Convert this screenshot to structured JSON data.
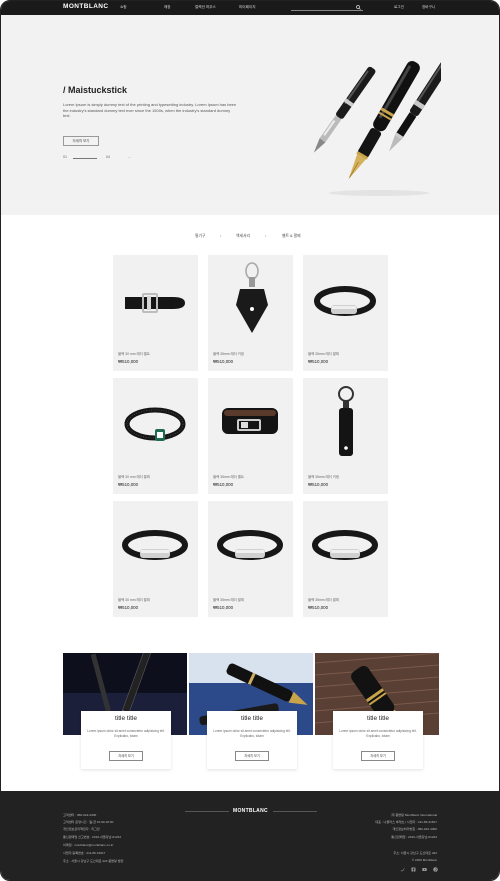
{
  "header": {
    "logo": "MONTBLANC",
    "nav": [
      "쇼핑",
      "매장",
      "컬렉션 하우스",
      "마이페이지"
    ],
    "right_nav": [
      "로그인",
      "장바구니"
    ]
  },
  "hero": {
    "title": "/ Maistuckstick",
    "text": "Lorem Ipsum is simply dummy text of the printing and typesetting industry. Lorem Ipsum has been the industry's standard dummy text ever since the 1500s, when the industry's standard dummy text.",
    "button": "자세히 보기",
    "slide_current": "01",
    "slide_total": "04",
    "next_arrow": "→"
  },
  "tabs": {
    "items": [
      "필기구",
      "액세서리",
      "벨트 & 팔찌"
    ],
    "separator": "•"
  },
  "products": [
    {
      "name": "블랙 30 mm 레더 벨트",
      "price": "₩510,000"
    },
    {
      "name": "블랙 35mm 레더 키링",
      "price": "₩510,000"
    },
    {
      "name": "블랙 35mm 레더 팔찌",
      "price": "₩510,000"
    },
    {
      "name": "블랙 30 mm 레더 팔찌",
      "price": "₩510,000"
    },
    {
      "name": "블랙 35mm 레더 벨트",
      "price": "₩510,000"
    },
    {
      "name": "블랙 35mm 레더 키링",
      "price": "₩510,000"
    },
    {
      "name": "블랙 30 mm 레더 팔찌",
      "price": "₩510,000"
    },
    {
      "name": "블랙 35mm 레더 팔찌",
      "price": "₩510,000"
    },
    {
      "name": "블랙 35mm 레더 팔찌",
      "price": "₩510,000"
    }
  ],
  "features": [
    {
      "title": "title title",
      "text": "Lorem ipsum dolor sit amet consectetur adipisicing elit. Explicabo, totam",
      "button": "자세히 보기"
    },
    {
      "title": "title title",
      "text": "Lorem ipsum dolor sit amet consectetur adipisicing elit. Explicabo, totam",
      "button": "자세히 보기"
    },
    {
      "title": "title title",
      "text": "Lorem ipsum dolor sit amet consectetur adipisicing elit. Explicabo, totam",
      "button": "자세히 보기"
    }
  ],
  "footer": {
    "logo": "MONTBLANC",
    "left": [
      "고객센터 : 080-022-4300",
      "고객센터 운영시간 : 월-금 10:00-18:00",
      "개인정보관리책임자 : 리그만",
      "통신판매업 신고번호 : 2016-서울강남-01234",
      "이메일 : montblanc@montblanc.co.kr",
      "사업자 등록번호 : 211-86-31817",
      "주소 : 서울시 강남구 도산대로 422 몽블랑 빌딩"
    ],
    "right": [
      "㈜ 몽블랑 Montblanc International",
      "대표 : 니콜라스 바레츠 | 사업자 : 211-86-31817",
      "개인정보처리방침 : 080-022-4300",
      "통신판매업 : 2016-서울강남-01234",
      "주소: 서울시 강남구 도산대로 422",
      "© 2020 Montblanc"
    ],
    "social_icons": [
      "twitter-icon",
      "facebook-icon",
      "youtube-icon",
      "pinterest-icon"
    ]
  }
}
